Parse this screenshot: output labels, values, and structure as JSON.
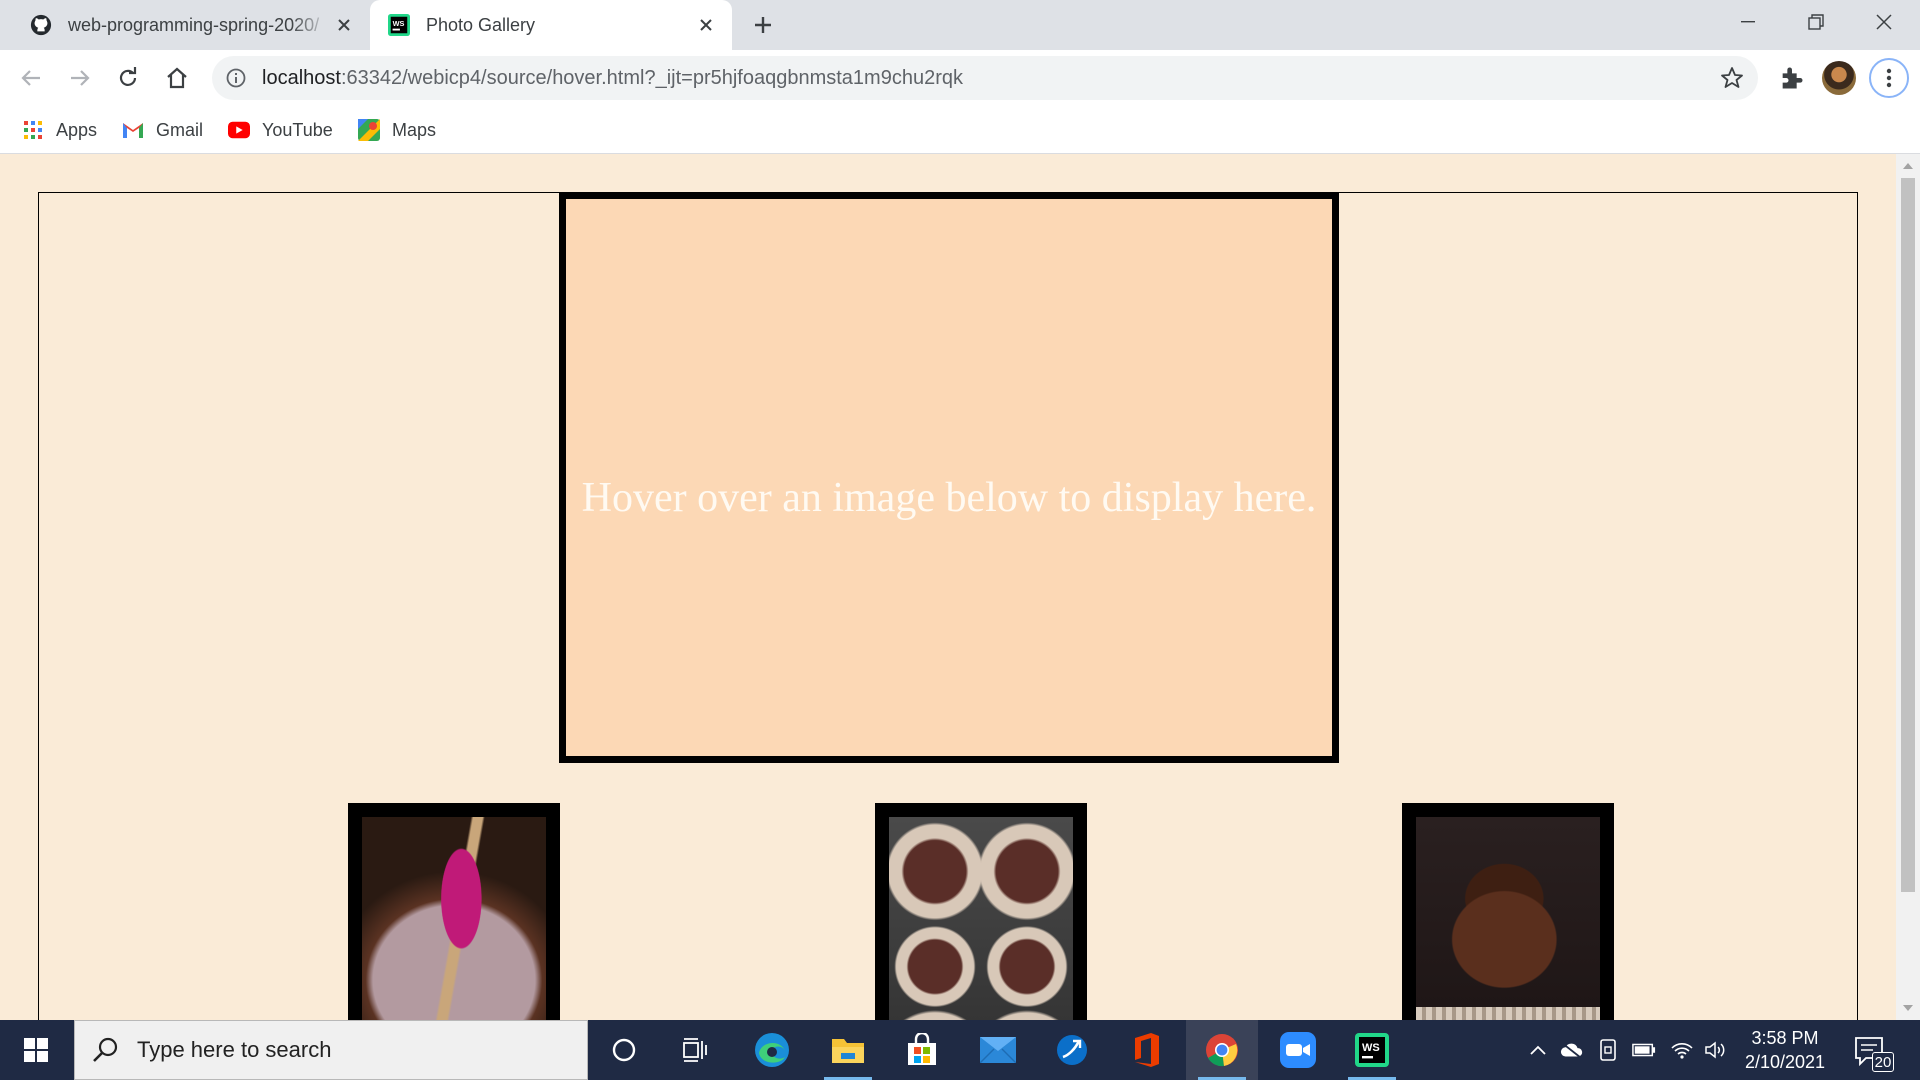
{
  "tabs": [
    {
      "title": "web-programming-spring-2020/",
      "icon": "github-icon"
    },
    {
      "title": "Photo Gallery",
      "icon": "webstorm-icon"
    }
  ],
  "address_bar": {
    "host": "localhost",
    "path": ":63342/webicp4/source/hover.html?_ijt=pr5hjfoaqgbnmsta1m9chu2rqk"
  },
  "bookmarks": [
    {
      "label": "Apps",
      "icon": "apps-grid-icon"
    },
    {
      "label": "Gmail",
      "icon": "gmail-icon"
    },
    {
      "label": "YouTube",
      "icon": "youtube-icon"
    },
    {
      "label": "Maps",
      "icon": "maps-icon"
    }
  ],
  "page": {
    "display_text": "Hover over an image below to display here.",
    "background_color": "#faebd7",
    "display_color": "#fcd8b5",
    "thumbnails": [
      {
        "subject": "chocolate batter bowl with spatula"
      },
      {
        "subject": "muffin tin with batter-filled liners"
      },
      {
        "subject": "chocolate frosted cupcake"
      }
    ]
  },
  "taskbar": {
    "search_placeholder": "Type here to search",
    "time": "3:58 PM",
    "date": "2/10/2021",
    "notification_count": "20",
    "pinned": [
      "cortana-icon",
      "task-view-icon",
      "edge-icon",
      "file-explorer-icon",
      "store-icon",
      "mail-icon",
      "app-icon",
      "office-icon",
      "chrome-icon",
      "zoom-icon",
      "webstorm-icon"
    ]
  }
}
